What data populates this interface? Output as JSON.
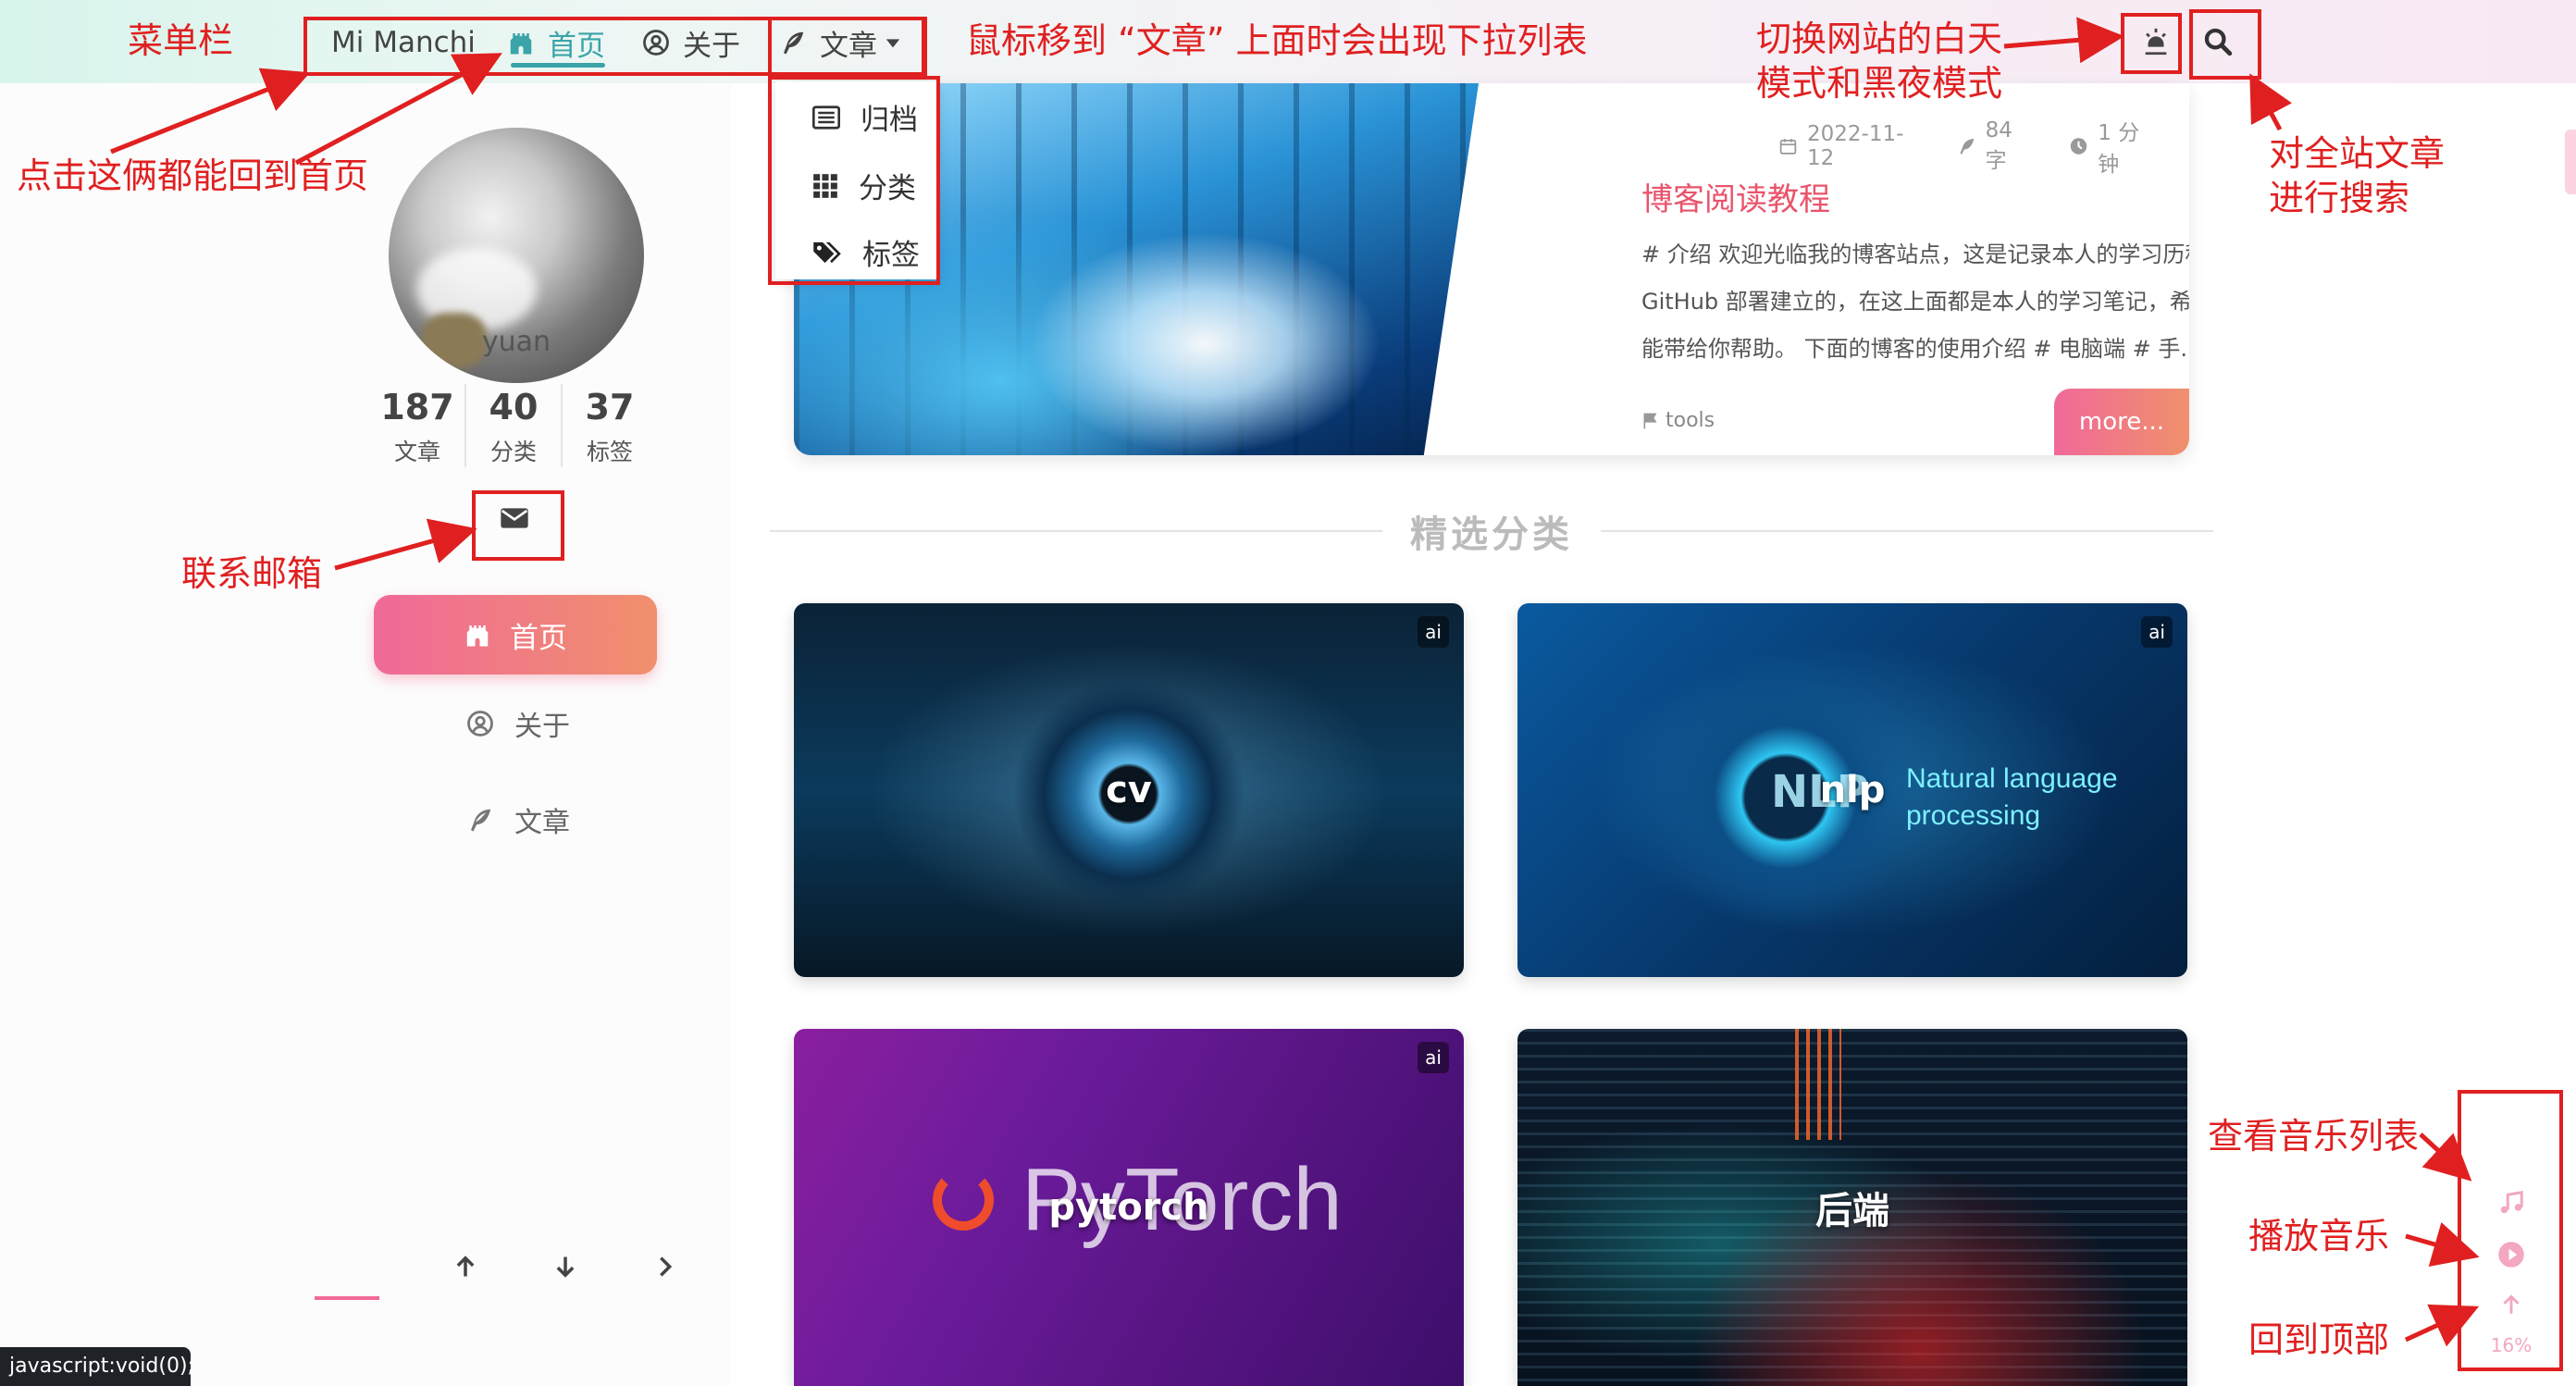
{
  "navbar": {
    "brand": "Mi Manchi",
    "items": [
      {
        "label": "首页",
        "icon": "castle-icon",
        "active": true
      },
      {
        "label": "关于",
        "icon": "user-circle-icon"
      },
      {
        "label": "文章",
        "icon": "feather-icon",
        "has_dropdown": true
      }
    ],
    "dropdown": [
      {
        "label": "归档",
        "icon": "archive-list-icon"
      },
      {
        "label": "分类",
        "icon": "grid-icon"
      },
      {
        "label": "标签",
        "icon": "tags-icon"
      }
    ],
    "accent_color": "#3aa4a8"
  },
  "sidebar": {
    "author": "yuan",
    "stats": [
      {
        "value": "187",
        "label": "文章"
      },
      {
        "value": "40",
        "label": "分类"
      },
      {
        "value": "37",
        "label": "标签"
      }
    ],
    "menu": [
      {
        "label": "首页",
        "icon": "castle-icon",
        "active": true
      },
      {
        "label": "关于",
        "icon": "user-circle-icon"
      },
      {
        "label": "文章",
        "icon": "feather-icon"
      }
    ]
  },
  "post": {
    "date": "2022-11-12",
    "words": "84 字",
    "read_time": "1 分钟",
    "title": "博客阅读教程",
    "excerpt": "# 介绍 欢迎光临我的博客站点，这是记录本人的学习历程而基于 GitHub 部署建立的，在这上面都是本人的学习笔记，希望阅读时能带给你帮助。 下面的博客的使用介绍 # 电脑端 # 手...",
    "tag": "tools",
    "more_label": "more..."
  },
  "section": {
    "title": "精选分类"
  },
  "categories": [
    {
      "label": "cv",
      "tag": "ai"
    },
    {
      "label": "nlp",
      "tag": "ai",
      "art_text_1": "NLP",
      "art_text_2": "Natural language",
      "art_text_3": "processing"
    },
    {
      "label": "pytorch",
      "tag": "ai",
      "art_text": "PyTorch"
    },
    {
      "label": "后端",
      "tag": ""
    }
  ],
  "floating_tools": {
    "scroll_percent": "16%"
  },
  "statusbar": {
    "text": "javascript:void(0);"
  },
  "annotations": {
    "menu_bar": "菜单栏",
    "home_click": "点击这俩都能回到首页",
    "dropdown_hint": "鼠标移到 “文章” 上面时会出现下拉列表",
    "theme_toggle_line1": "切换网站的白天",
    "theme_toggle_line2": "模式和黑夜模式",
    "search_line1": "对全站文章",
    "search_line2": "进行搜索",
    "email": "联系邮箱",
    "music_list": "查看音乐列表",
    "play_music": "播放音乐",
    "back_to_top": "回到顶部",
    "color": "#e02020"
  }
}
